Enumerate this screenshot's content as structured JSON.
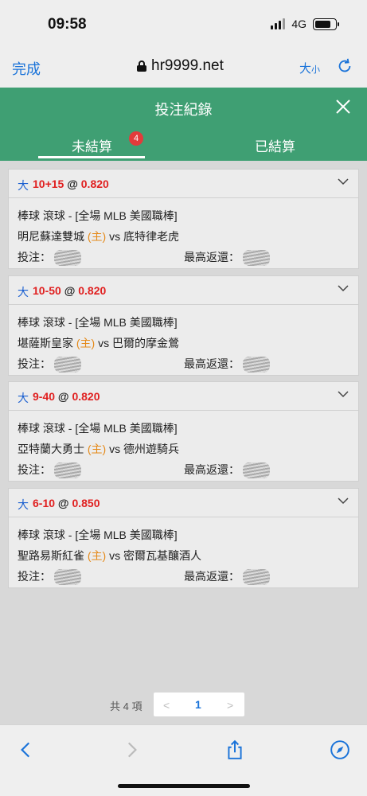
{
  "status": {
    "time": "09:58",
    "network": "4G"
  },
  "browser": {
    "done_label": "完成",
    "url": "hr9999.net",
    "text_size_big": "大",
    "text_size_small": "小"
  },
  "header": {
    "title": "投注紀錄"
  },
  "tabs": [
    {
      "label": "未結算",
      "count": "4"
    },
    {
      "label": "已結算"
    }
  ],
  "bets": [
    {
      "prefix": "大",
      "selection": "10+15",
      "at": "@",
      "odds": "0.820",
      "sport": "棒球 滾球 - [全場 MLB 美國職棒]",
      "home": "明尼蘇達雙城",
      "home_tag": "(主)",
      "vs": "vs",
      "away": "底特律老虎",
      "stake_label": "投注：",
      "max_return_label": "最高返還："
    },
    {
      "prefix": "大",
      "selection": "10-50",
      "at": "@",
      "odds": "0.820",
      "sport": "棒球 滾球 - [全場 MLB 美國職棒]",
      "home": "堪薩斯皇家",
      "home_tag": "(主)",
      "vs": "vs",
      "away": "巴爾的摩金鶯",
      "stake_label": "投注：",
      "max_return_label": "最高返還："
    },
    {
      "prefix": "大",
      "selection": "9-40",
      "at": "@",
      "odds": "0.820",
      "sport": "棒球 滾球 - [全場 MLB 美國職棒]",
      "home": "亞特蘭大勇士",
      "home_tag": "(主)",
      "vs": "vs",
      "away": "德州遊騎兵",
      "stake_label": "投注：",
      "max_return_label": "最高返還："
    },
    {
      "prefix": "大",
      "selection": "6-10",
      "at": "@",
      "odds": "0.850",
      "sport": "棒球 滾球 - [全場 MLB 美國職棒]",
      "home": "聖路易斯紅雀",
      "home_tag": "(主)",
      "vs": "vs",
      "away": "密爾瓦基釀酒人",
      "stake_label": "投注：",
      "max_return_label": "最高返還："
    }
  ],
  "pagination": {
    "total": "共 4 項",
    "current": "1",
    "prev": "<",
    "next": ">"
  },
  "colors": {
    "accent": "#3f9f73",
    "link": "#1a73d9",
    "odds": "#e02020",
    "home_tag": "#e58a1a",
    "badge": "#e23b3b"
  }
}
